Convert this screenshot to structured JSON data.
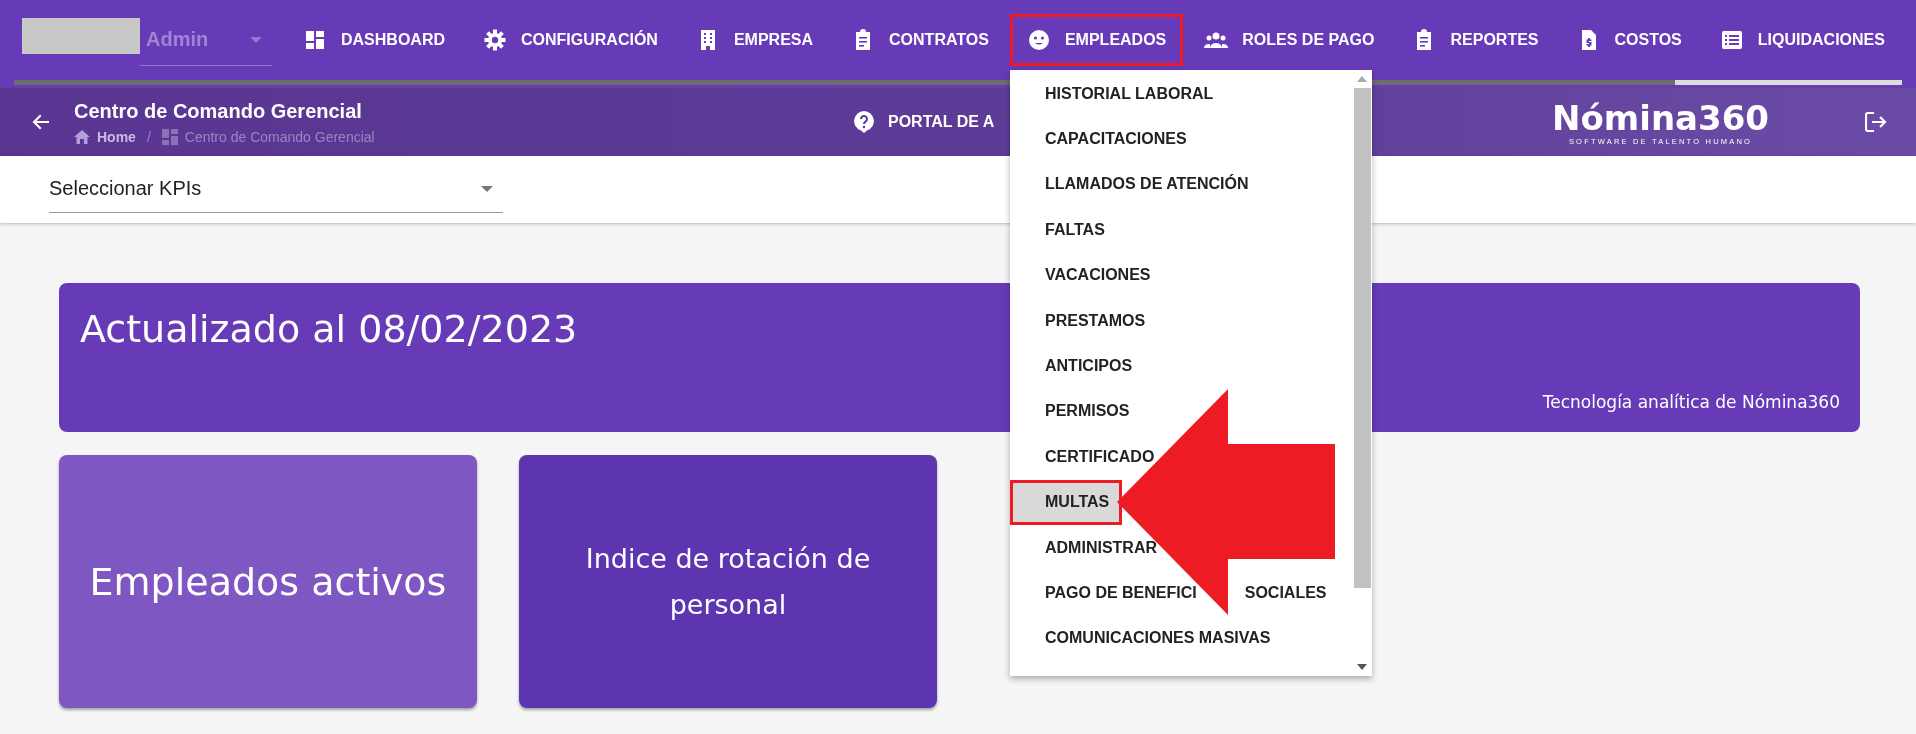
{
  "user_select": {
    "value": "Admin"
  },
  "nav": [
    {
      "label": "DASHBOARD",
      "annotated": false
    },
    {
      "label": "CONFIGURACIÓN",
      "annotated": false
    },
    {
      "label": "EMPRESA",
      "annotated": false
    },
    {
      "label": "CONTRATOS",
      "annotated": false
    },
    {
      "label": "EMPLEADOS",
      "annotated": true
    },
    {
      "label": "ROLES DE PAGO",
      "annotated": false
    },
    {
      "label": "REPORTES",
      "annotated": false
    },
    {
      "label": "COSTOS",
      "annotated": false
    },
    {
      "label": "LIQUIDACIONES",
      "annotated": false
    }
  ],
  "progress": {
    "level": 0.88
  },
  "header": {
    "title": "Centro de Comando Gerencial",
    "breadcrumb": [
      "Home",
      "Centro de Comando Gerencial"
    ],
    "breadcrumb_separator": "/",
    "portal_link": "PORTAL DE A",
    "logo": {
      "name": "Nómina360",
      "tagline": "SOFTWARE DE TALENTO HUMANO"
    }
  },
  "kpi_select": {
    "value": "Seleccionar KPIs"
  },
  "banner": {
    "title": "Actualizado al 08/02/2023",
    "caption": "Tecnología analítica de Nómina360"
  },
  "cards": [
    {
      "label": "Empleados activos",
      "color": "#7e57c2"
    },
    {
      "label": "Indice de rotación de personal",
      "color": "#5e35b1"
    }
  ],
  "dropdown": {
    "items": [
      {
        "parts": [
          "HISTORIAL LABORAL"
        ],
        "selected": false,
        "annotated": false
      },
      {
        "parts": [
          "CAPACITACIONES"
        ],
        "selected": false,
        "annotated": false
      },
      {
        "parts": [
          "LLAMADOS DE ATENCIÓN"
        ],
        "selected": false,
        "annotated": false
      },
      {
        "parts": [
          "FALTAS"
        ],
        "selected": false,
        "annotated": false
      },
      {
        "parts": [
          "VACACIONES"
        ],
        "selected": false,
        "annotated": false
      },
      {
        "parts": [
          "PRESTAMOS"
        ],
        "selected": false,
        "annotated": false
      },
      {
        "parts": [
          "ANTICIPOS"
        ],
        "selected": false,
        "annotated": false
      },
      {
        "parts": [
          "PERMISOS"
        ],
        "selected": false,
        "annotated": false
      },
      {
        "parts": [
          "CERTIFICADO"
        ],
        "selected": false,
        "annotated": false
      },
      {
        "parts": [
          "MULTAS"
        ],
        "selected": true,
        "annotated": true
      },
      {
        "parts": [
          "ADMINISTRAR"
        ],
        "selected": false,
        "annotated": false
      },
      {
        "parts": [
          "PAGO DE BENEFICI",
          "SOCIALES"
        ],
        "selected": false,
        "annotated": false
      },
      {
        "parts": [
          "COMUNICACIONES MASIVAS"
        ],
        "selected": false,
        "annotated": false
      }
    ]
  }
}
